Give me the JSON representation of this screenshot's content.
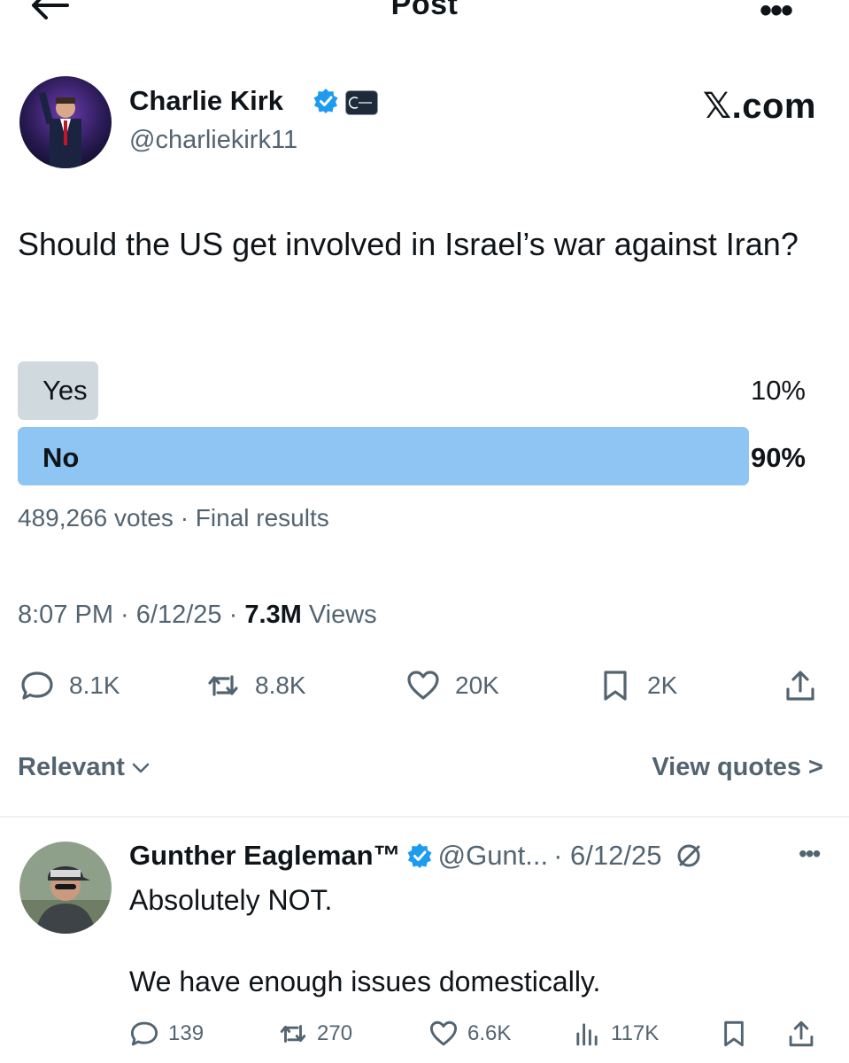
{
  "header": {
    "title": "Post",
    "back_icon": "back-arrow-icon",
    "more_icon": "more-icon",
    "more_glyph": "•••"
  },
  "author": {
    "name": "Charlie Kirk",
    "handle": "@charliekirk11",
    "verified": true
  },
  "site_mark": "𝕏.com",
  "post": {
    "text": "Should the US get involved in Israel’s war against Iran?"
  },
  "poll": {
    "options": [
      {
        "label": "Yes",
        "percent_text": "10%",
        "share": 10
      },
      {
        "label": "No",
        "percent_text": "90%",
        "share": 90
      }
    ],
    "meta": "489,266 votes · Final results"
  },
  "timestamp": {
    "time_date": "8:07 PM · 6/12/25 · ",
    "views_count": "7.3M",
    "views_label": " Views"
  },
  "actions": {
    "replies": "8.1K",
    "reposts": "8.8K",
    "likes": "20K",
    "bookmarks": "2K"
  },
  "sort": {
    "label": "Relevant",
    "quotes_label": "View quotes >"
  },
  "reply": {
    "name": "Gunther Eagleman™",
    "handle": "@Gunt...",
    "date": "· 6/12/25",
    "more_glyph": "•••",
    "line1": "Absolutely NOT.",
    "line2": "We have enough issues domestically.",
    "actions": {
      "replies": "139",
      "reposts": "270",
      "likes": "6.6K",
      "views": "117K"
    }
  },
  "colors": {
    "verified": "#1d9bf0",
    "poll_winner": "#8ec5f2",
    "poll_other": "#cfd9de",
    "muted": "#536471"
  }
}
